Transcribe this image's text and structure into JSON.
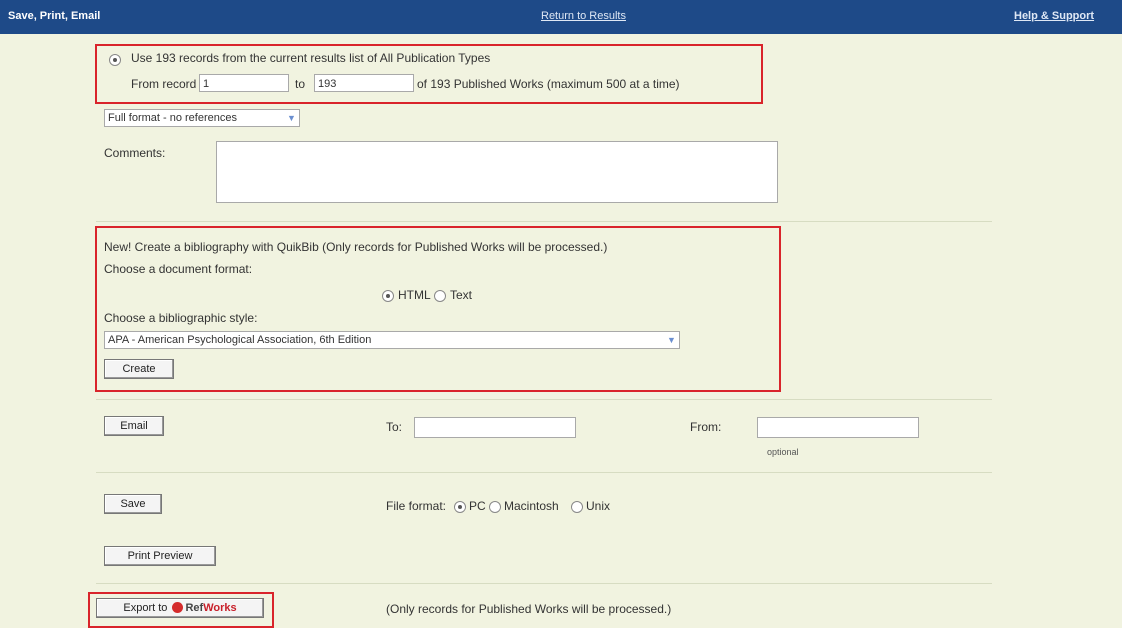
{
  "topbar": {
    "title": "Save, Print, Email",
    "return_link": "Return to Results",
    "help_link": "Help & Support"
  },
  "records": {
    "use_text": "Use 193 records from the current results list of All Publication Types",
    "from_label": "From record",
    "from_value": "1",
    "to_label": "to",
    "to_value": "193",
    "of_text": "of 193 Published Works (maximum 500 at a time)"
  },
  "format_select": {
    "value": "Full format - no references"
  },
  "comments": {
    "label": "Comments:"
  },
  "quikbib": {
    "intro": "New! Create a bibliography with QuikBib (Only records for Published Works will be processed.)",
    "doc_format_label": "Choose a document format:",
    "html_label": "HTML",
    "text_label": "Text",
    "style_label": "Choose a bibliographic style:",
    "style_value": "APA - American Psychological Association, 6th Edition",
    "create_button": "Create"
  },
  "email": {
    "button": "Email",
    "to_label": "To:",
    "from_label": "From:",
    "optional": "optional"
  },
  "save": {
    "button": "Save",
    "file_format_label": "File format:",
    "pc": "PC",
    "mac": "Macintosh",
    "unix": "Unix"
  },
  "print": {
    "button": "Print Preview"
  },
  "export": {
    "prefix": "Export to",
    "brand_ref": "Ref",
    "brand_works": "Works",
    "note": "(Only records for Published Works will be processed.)"
  },
  "colors": {
    "header_bg": "#1e4a88",
    "page_bg": "#f1f3e0",
    "highlight_border": "#d9242b"
  }
}
